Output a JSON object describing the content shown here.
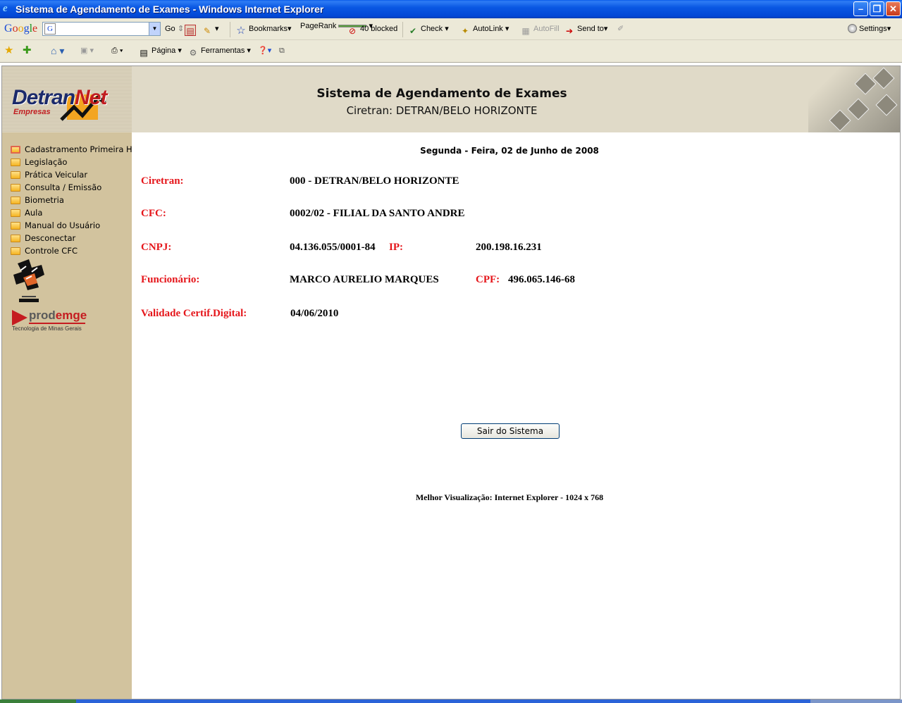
{
  "window": {
    "title": "Sistema de Agendamento de Exames - Windows Internet Explorer",
    "min_symbol": "–",
    "max_symbol": "❐",
    "close_symbol": "✕"
  },
  "google_toolbar": {
    "logo": [
      "G",
      "o",
      "o",
      "g",
      "l",
      "e"
    ],
    "go_label": "Go",
    "bookmarks_label": "Bookmarks▾",
    "pagerank_label": "PageRank",
    "blocked_label": "40 blocked",
    "check_label": "Check",
    "autolink_label": "AutoLink",
    "autofill_label": "AutoFill",
    "sendto_label": "Send to▾",
    "settings_label": "Settings▾"
  },
  "ie_toolbar": {
    "pagina_label": "Página",
    "ferramentas_label": "Ferramentas"
  },
  "header": {
    "title": "Sistema de Agendamento de Exames",
    "subtitle": "Ciretran: DETRAN/BELO HORIZONTE"
  },
  "logos": {
    "detran_main": "Detran",
    "detran_accent": "Net",
    "detran_sub": "Empresas",
    "prodemge_a": "prod",
    "prodemge_b": "emge",
    "prodemge_sub": "Tecnologia de Minas Gerais"
  },
  "sidebar": {
    "items": [
      {
        "label": "Cadastramento Primeira Habilitação"
      },
      {
        "label": "Legislação"
      },
      {
        "label": "Prática Veicular"
      },
      {
        "label": "Consulta / Emissão"
      },
      {
        "label": "Biometria"
      },
      {
        "label": "Aula"
      },
      {
        "label": "Manual do Usuário"
      },
      {
        "label": "Desconectar"
      },
      {
        "label": "Controle CFC"
      }
    ]
  },
  "main": {
    "date": "Segunda - Feira, 02 de Junho de 2008",
    "ciretran_label": "Ciretran:",
    "ciretran_value": "000 - DETRAN/BELO HORIZONTE",
    "cfc_label": "CFC:",
    "cfc_value": "0002/02 - FILIAL DA SANTO ANDRE",
    "cnpj_label": "CNPJ:",
    "cnpj_value": "04.136.055/0001-84",
    "ip_label": "IP:",
    "ip_value": "200.198.16.231",
    "funcionario_label": "Funcionário:",
    "funcionario_value": "MARCO AURELIO MARQUES",
    "cpf_label": "CPF:",
    "cpf_value": "496.065.146-68",
    "validade_label": "Validade Certif.Digital:",
    "validade_value": "04/06/2010",
    "exit_button": "Sair do Sistema",
    "footer_note": "Melhor Visualização: Internet Explorer - 1024 x 768"
  },
  "colors": {
    "label_red": "#e5161b",
    "sidebar_bg": "#d2c39e",
    "header_bg": "#e0dac8",
    "titlebar_blue": "#0a58e3"
  }
}
